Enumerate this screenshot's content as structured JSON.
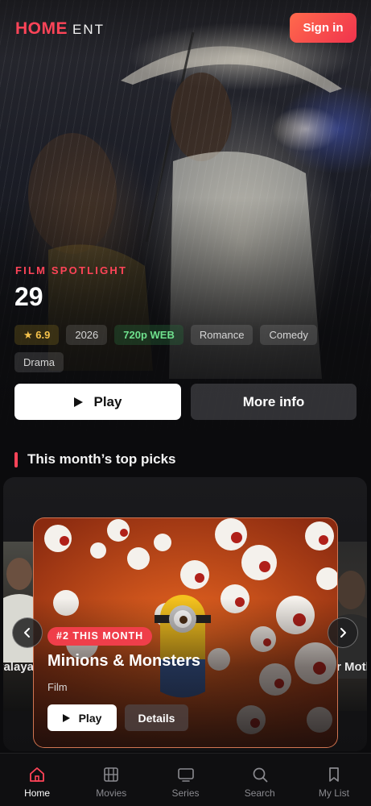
{
  "header": {
    "logo_primary": "HOME",
    "logo_secondary": "ENT",
    "sign_in_label": "Sign in"
  },
  "hero": {
    "eyebrow": "FILM SPOTLIGHT",
    "title": "29",
    "rating": "★ 6.9",
    "tags": [
      "2026",
      "720p WEB",
      "Romance",
      "Comedy",
      "Drama"
    ],
    "play_label": "Play",
    "more_info_label": "More info"
  },
  "section": {
    "title": "This month’s top picks"
  },
  "carousel": {
    "left_peek_text": "ıyalaya",
    "right_peek_text": "r Motl",
    "featured": {
      "rank_badge": "#2 THIS MONTH",
      "title": "Minions & Monsters",
      "type": "Film",
      "play_label": "Play",
      "details_label": "Details"
    }
  },
  "bottom_nav": {
    "items": [
      {
        "label": "Home",
        "icon": "home-icon",
        "active": true
      },
      {
        "label": "Movies",
        "icon": "film-icon",
        "active": false
      },
      {
        "label": "Series",
        "icon": "tv-icon",
        "active": false
      },
      {
        "label": "Search",
        "icon": "search-icon",
        "active": false
      },
      {
        "label": "My List",
        "icon": "bookmark-icon",
        "active": false
      }
    ]
  },
  "colors": {
    "accent": "#ff4458",
    "rating": "#f5c24b",
    "quality": "#6fe08d",
    "background": "#0b0b0d"
  }
}
